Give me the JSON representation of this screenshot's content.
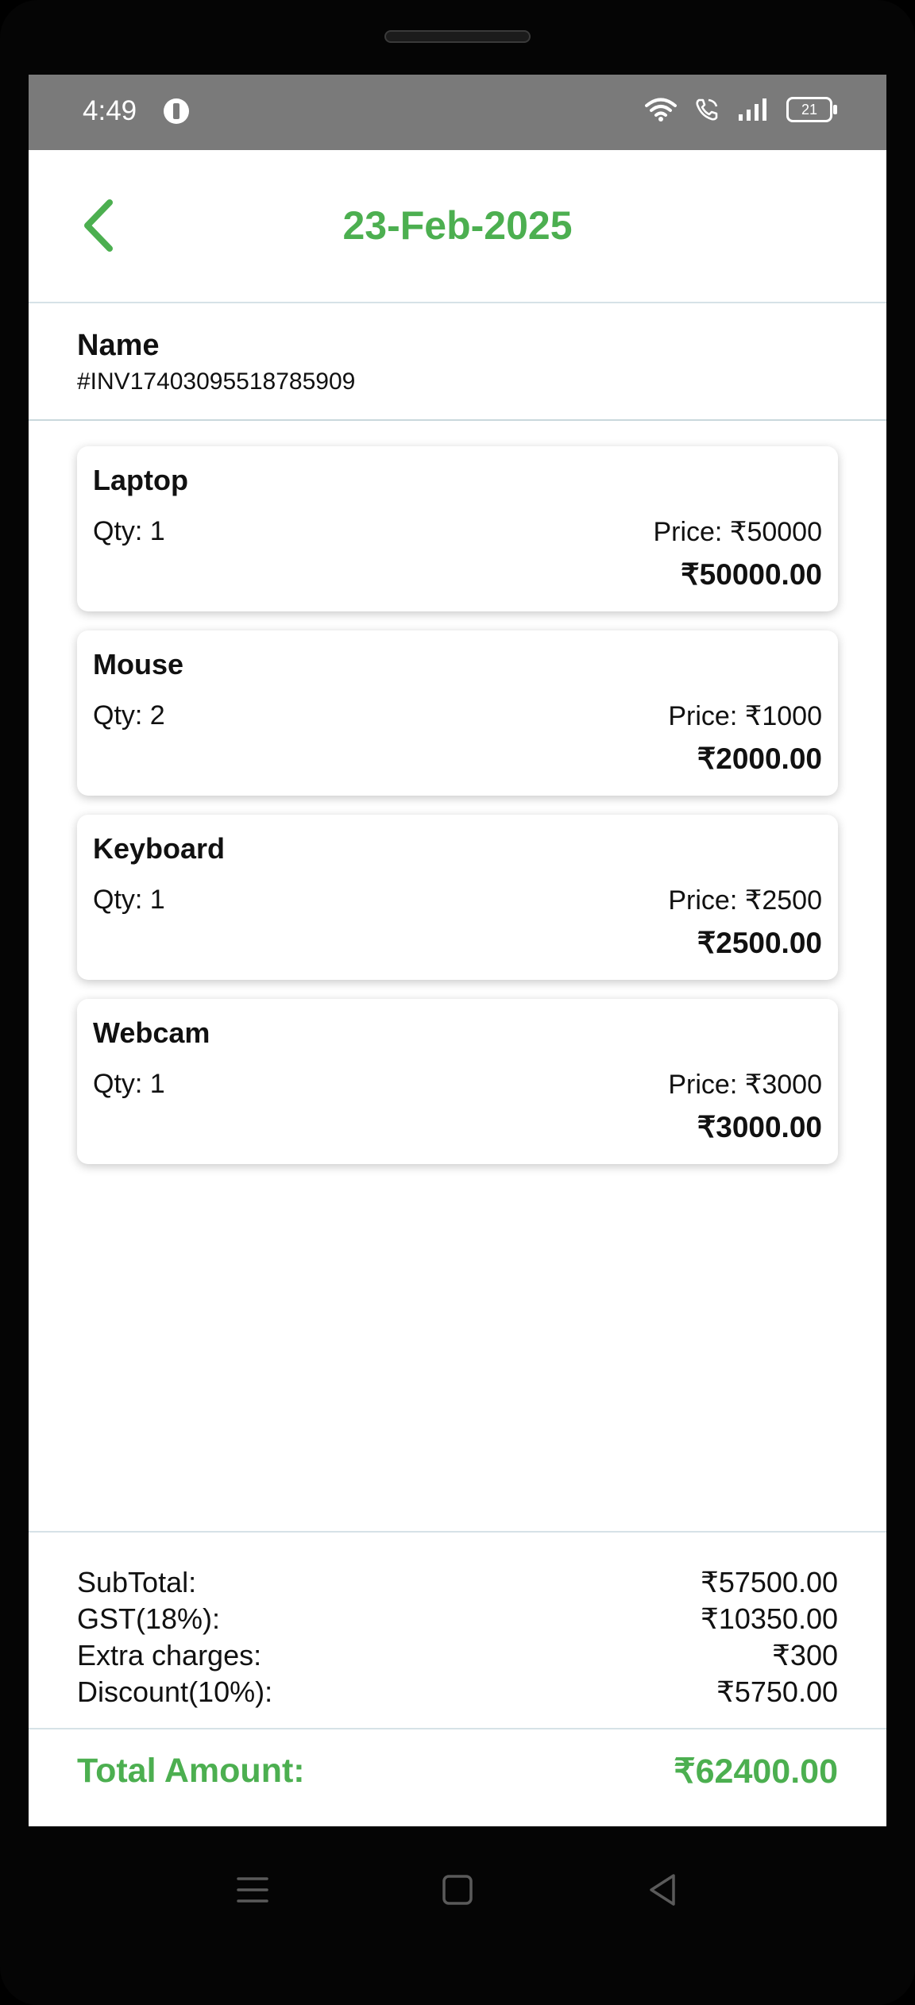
{
  "status_bar": {
    "time": "4:49",
    "battery": "21"
  },
  "header": {
    "title": "23-Feb-2025"
  },
  "customer": {
    "name": "Name",
    "invoice_number": "#INV17403095518785909"
  },
  "items": [
    {
      "name": "Laptop",
      "qty": "Qty: 1",
      "price": "Price: ₹50000",
      "total": "₹50000.00"
    },
    {
      "name": "Mouse",
      "qty": "Qty: 2",
      "price": "Price: ₹1000",
      "total": "₹2000.00"
    },
    {
      "name": "Keyboard",
      "qty": "Qty: 1",
      "price": "Price: ₹2500",
      "total": "₹2500.00"
    },
    {
      "name": "Webcam",
      "qty": "Qty: 1",
      "price": "Price: ₹3000",
      "total": "₹3000.00"
    }
  ],
  "summary": {
    "subtotal_label": "SubTotal:",
    "subtotal_value": "₹57500.00",
    "gst_label": "GST(18%):",
    "gst_value": "₹10350.00",
    "extra_label": "Extra charges:",
    "extra_value": "₹300",
    "discount_label": "Discount(10%):",
    "discount_value": "₹5750.00",
    "total_label": "Total Amount:",
    "total_value": "₹62400.00"
  },
  "colors": {
    "accent": "#4caf50",
    "status_bar": "#7a7a7a",
    "divider": "#d6e2e7"
  },
  "icons": {
    "back": "chevron-left-icon",
    "nav_menu": "menu-icon",
    "nav_home": "square-home-icon",
    "nav_back": "triangle-back-icon"
  }
}
